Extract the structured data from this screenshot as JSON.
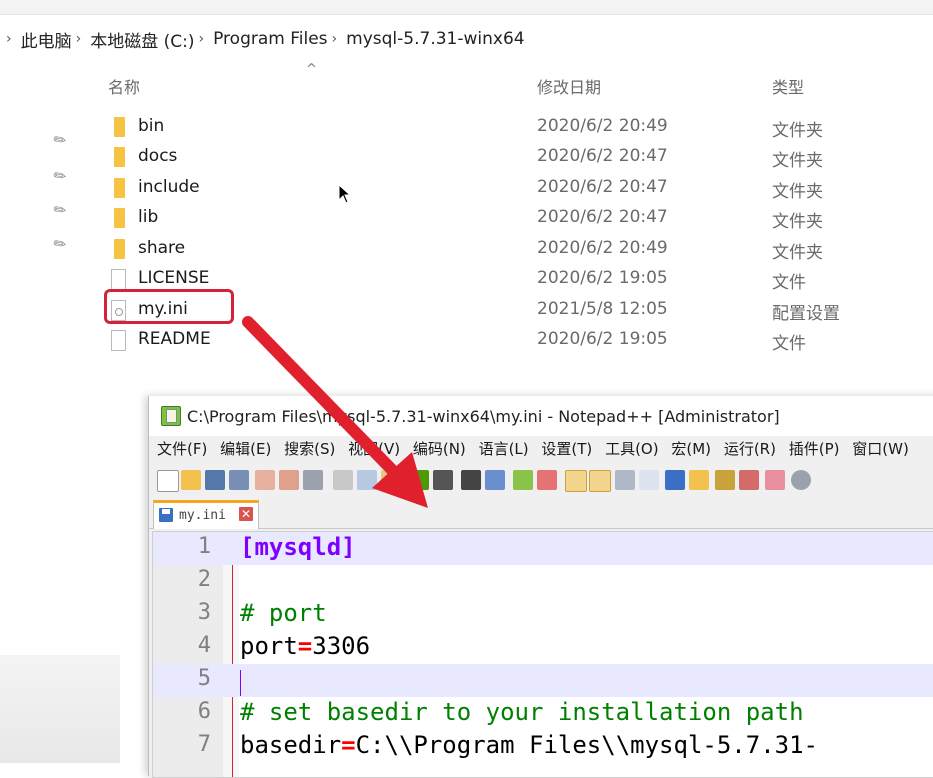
{
  "explorer": {
    "breadcrumb": [
      "此电脑",
      "本地磁盘 (C:)",
      "Program Files",
      "mysql-5.7.31-winx64"
    ],
    "columns": {
      "name": "名称",
      "modified": "修改日期",
      "type": "类型"
    },
    "files": [
      {
        "name": "bin",
        "date": "2020/6/2 20:49",
        "type": "文件夹",
        "icon": "folder-icon"
      },
      {
        "name": "docs",
        "date": "2020/6/2 20:47",
        "type": "文件夹",
        "icon": "folder-icon"
      },
      {
        "name": "include",
        "date": "2020/6/2 20:47",
        "type": "文件夹",
        "icon": "folder-icon"
      },
      {
        "name": "lib",
        "date": "2020/6/2 20:47",
        "type": "文件夹",
        "icon": "folder-icon"
      },
      {
        "name": "share",
        "date": "2020/6/2 20:49",
        "type": "文件夹",
        "icon": "folder-icon"
      },
      {
        "name": "LICENSE",
        "date": "2020/6/2 19:05",
        "type": "文件",
        "icon": "file-icon"
      },
      {
        "name": "my.ini",
        "date": "2021/5/8 12:05",
        "type": "配置设置",
        "icon": "settings-file-icon"
      },
      {
        "name": "README",
        "date": "2020/6/2 19:05",
        "type": "文件",
        "icon": "file-icon"
      }
    ],
    "highlight_color": "#d4223a"
  },
  "notepad": {
    "title": "C:\\Program Files\\mysql-5.7.31-winx64\\my.ini - Notepad++ [Administrator]",
    "menu": [
      "文件(F)",
      "编辑(E)",
      "搜索(S)",
      "视图(V)",
      "编码(N)",
      "语言(L)",
      "设置(T)",
      "工具(O)",
      "宏(M)",
      "运行(R)",
      "插件(P)",
      "窗口(W)"
    ],
    "tab_label": "my.ini",
    "lines": [
      {
        "n": "1",
        "kind": "section",
        "text": "[mysqld]"
      },
      {
        "n": "2",
        "kind": "empty",
        "text": ""
      },
      {
        "n": "3",
        "kind": "comment",
        "text": "# port"
      },
      {
        "n": "4",
        "kind": "kv",
        "key": "port",
        "op": "=",
        "value": "3306"
      },
      {
        "n": "5",
        "kind": "empty",
        "text": ""
      },
      {
        "n": "6",
        "kind": "comment",
        "text": "# set basedir to your installation path"
      },
      {
        "n": "7",
        "kind": "kv",
        "key": "basedir",
        "op": "=",
        "value": "C:\\\\Program Files\\\\mysql-5.7.31-"
      }
    ],
    "colors": {
      "section": "#8000ff",
      "comment": "#008000",
      "operator": "#ff0000",
      "current_line": "#e8e8ff"
    }
  }
}
